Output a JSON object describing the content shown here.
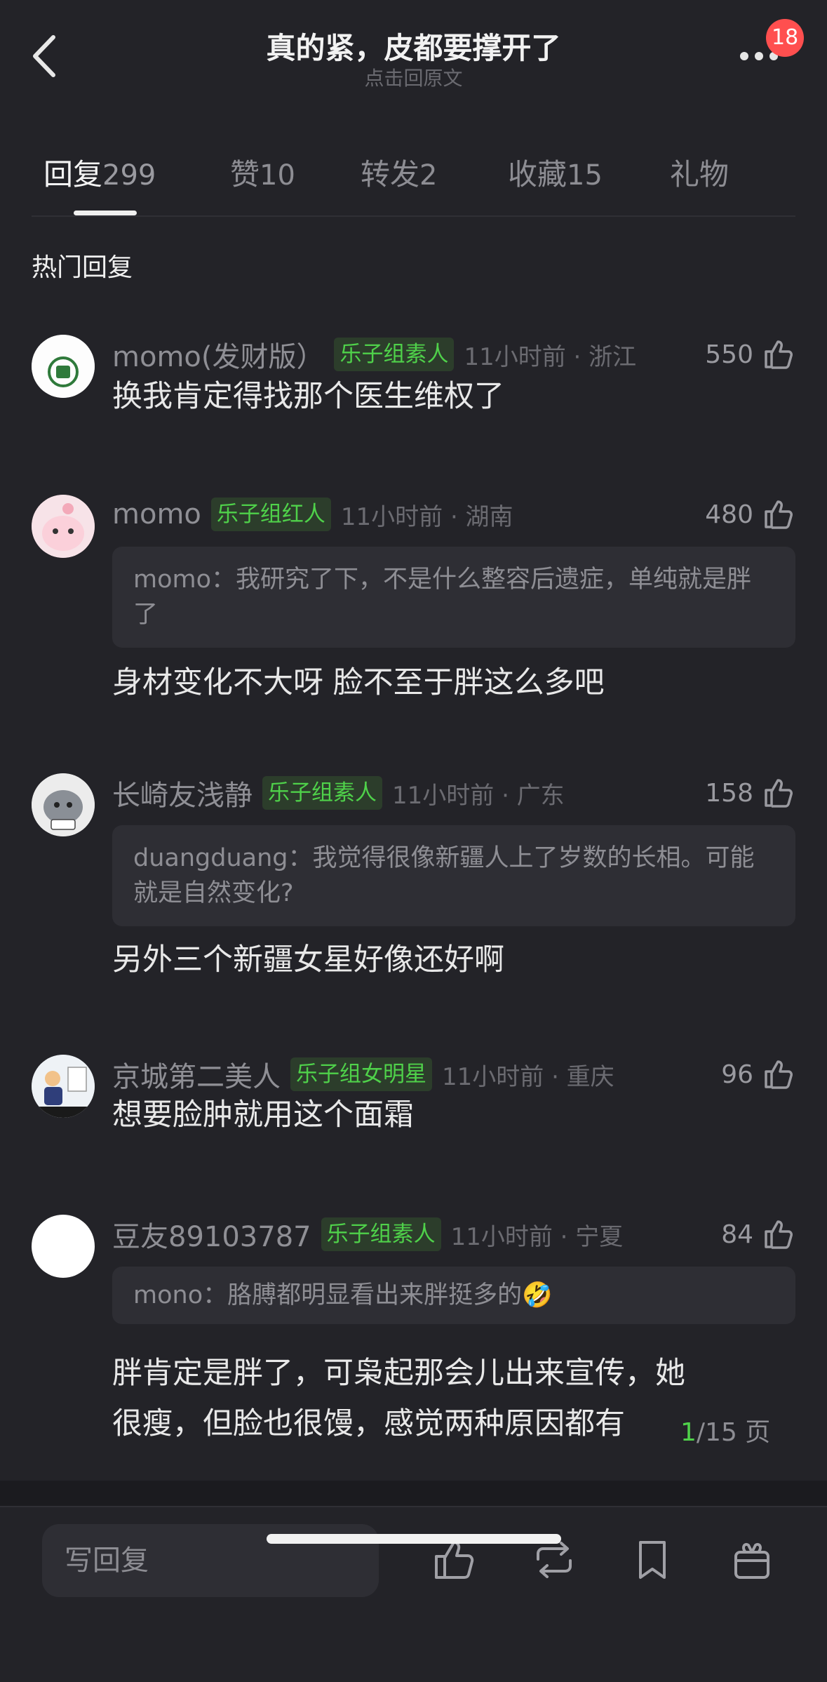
{
  "header": {
    "title": "真的紧，皮都要撑开了",
    "subtitle": "点击回原文",
    "badge": "18"
  },
  "tabs": [
    {
      "label": "回复",
      "count": "299"
    },
    {
      "label": "赞",
      "count": "10"
    },
    {
      "label": "转发",
      "count": "2"
    },
    {
      "label": "收藏",
      "count": "15"
    },
    {
      "label": "礼物",
      "count": ""
    }
  ],
  "section_title": "热门回复",
  "comments": [
    {
      "user": "momo(发财版）",
      "tag": "乐子组素人",
      "time": "11小时前 · 浙江",
      "likes": "550",
      "quote": "",
      "text": "换我肯定得找那个医生维权了"
    },
    {
      "user": "momo",
      "tag": "乐子组红人",
      "time": "11小时前 · 湖南",
      "likes": "480",
      "quote": "momo：我研究了下，不是什么整容后遗症，单纯就是胖了",
      "text": "身材变化不大呀 脸不至于胖这么多吧"
    },
    {
      "user": "长崎友浅静",
      "tag": "乐子组素人",
      "time": "11小时前 · 广东",
      "likes": "158",
      "quote": "duangduang：我觉得很像新疆人上了岁数的长相。可能就是自然变化?",
      "text": "另外三个新疆女星好像还好啊"
    },
    {
      "user": "京城第二美人",
      "tag": "乐子组女明星",
      "time": "11小时前 · 重庆",
      "likes": "96",
      "quote": "",
      "text": "想要脸肿就用这个面霜"
    },
    {
      "user": "豆友89103787",
      "tag": "乐子组素人",
      "time": "11小时前 · 宁夏",
      "likes": "84",
      "quote": "mono：胳膊都明显看出来胖挺多的🤣",
      "text": "胖肯定是胖了，可枭起那会儿出来宣传，她很瘦，但脸也很馒，感觉两种原因都有"
    }
  ],
  "pager": {
    "current": "1",
    "total": "/15 页"
  },
  "bottom": {
    "reply_placeholder": "写回复",
    "icons": [
      "like-icon",
      "repost-icon",
      "bookmark-icon",
      "gift-icon"
    ]
  },
  "colors": {
    "background": "#232328",
    "tag_green": "#4fd14a",
    "badge_red": "#ff4f4f"
  }
}
